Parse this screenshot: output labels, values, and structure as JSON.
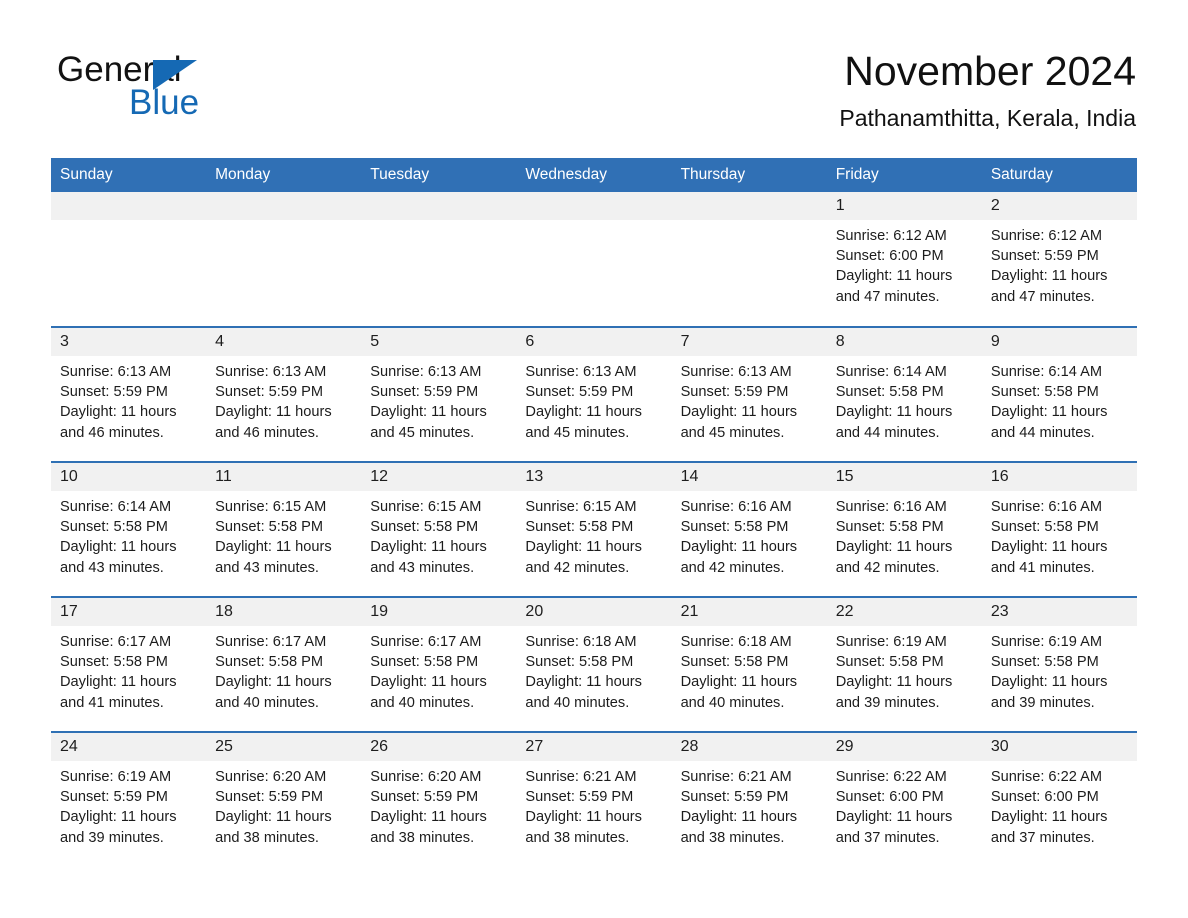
{
  "brand": {
    "name_part1": "General",
    "name_part2": "Blue",
    "flag_icon": "blue-triangle-flag-icon",
    "accent_color": "#1569b4"
  },
  "header": {
    "title": "November 2024",
    "location": "Pathanamthitta, Kerala, India"
  },
  "theme": {
    "header_row_bg": "#3070b5",
    "row_separator": "#2f70b4",
    "daynum_band_bg": "#f1f1f1",
    "page_bg": "#ffffff",
    "text": "#1c1c1c"
  },
  "calendar": {
    "weekday_headers": [
      "Sunday",
      "Monday",
      "Tuesday",
      "Wednesday",
      "Thursday",
      "Friday",
      "Saturday"
    ],
    "weeks": [
      [
        {
          "day": "",
          "lines": []
        },
        {
          "day": "",
          "lines": []
        },
        {
          "day": "",
          "lines": []
        },
        {
          "day": "",
          "lines": []
        },
        {
          "day": "",
          "lines": []
        },
        {
          "day": "1",
          "lines": [
            "Sunrise: 6:12 AM",
            "Sunset: 6:00 PM",
            "Daylight: 11 hours",
            "and 47 minutes."
          ]
        },
        {
          "day": "2",
          "lines": [
            "Sunrise: 6:12 AM",
            "Sunset: 5:59 PM",
            "Daylight: 11 hours",
            "and 47 minutes."
          ]
        }
      ],
      [
        {
          "day": "3",
          "lines": [
            "Sunrise: 6:13 AM",
            "Sunset: 5:59 PM",
            "Daylight: 11 hours",
            "and 46 minutes."
          ]
        },
        {
          "day": "4",
          "lines": [
            "Sunrise: 6:13 AM",
            "Sunset: 5:59 PM",
            "Daylight: 11 hours",
            "and 46 minutes."
          ]
        },
        {
          "day": "5",
          "lines": [
            "Sunrise: 6:13 AM",
            "Sunset: 5:59 PM",
            "Daylight: 11 hours",
            "and 45 minutes."
          ]
        },
        {
          "day": "6",
          "lines": [
            "Sunrise: 6:13 AM",
            "Sunset: 5:59 PM",
            "Daylight: 11 hours",
            "and 45 minutes."
          ]
        },
        {
          "day": "7",
          "lines": [
            "Sunrise: 6:13 AM",
            "Sunset: 5:59 PM",
            "Daylight: 11 hours",
            "and 45 minutes."
          ]
        },
        {
          "day": "8",
          "lines": [
            "Sunrise: 6:14 AM",
            "Sunset: 5:58 PM",
            "Daylight: 11 hours",
            "and 44 minutes."
          ]
        },
        {
          "day": "9",
          "lines": [
            "Sunrise: 6:14 AM",
            "Sunset: 5:58 PM",
            "Daylight: 11 hours",
            "and 44 minutes."
          ]
        }
      ],
      [
        {
          "day": "10",
          "lines": [
            "Sunrise: 6:14 AM",
            "Sunset: 5:58 PM",
            "Daylight: 11 hours",
            "and 43 minutes."
          ]
        },
        {
          "day": "11",
          "lines": [
            "Sunrise: 6:15 AM",
            "Sunset: 5:58 PM",
            "Daylight: 11 hours",
            "and 43 minutes."
          ]
        },
        {
          "day": "12",
          "lines": [
            "Sunrise: 6:15 AM",
            "Sunset: 5:58 PM",
            "Daylight: 11 hours",
            "and 43 minutes."
          ]
        },
        {
          "day": "13",
          "lines": [
            "Sunrise: 6:15 AM",
            "Sunset: 5:58 PM",
            "Daylight: 11 hours",
            "and 42 minutes."
          ]
        },
        {
          "day": "14",
          "lines": [
            "Sunrise: 6:16 AM",
            "Sunset: 5:58 PM",
            "Daylight: 11 hours",
            "and 42 minutes."
          ]
        },
        {
          "day": "15",
          "lines": [
            "Sunrise: 6:16 AM",
            "Sunset: 5:58 PM",
            "Daylight: 11 hours",
            "and 42 minutes."
          ]
        },
        {
          "day": "16",
          "lines": [
            "Sunrise: 6:16 AM",
            "Sunset: 5:58 PM",
            "Daylight: 11 hours",
            "and 41 minutes."
          ]
        }
      ],
      [
        {
          "day": "17",
          "lines": [
            "Sunrise: 6:17 AM",
            "Sunset: 5:58 PM",
            "Daylight: 11 hours",
            "and 41 minutes."
          ]
        },
        {
          "day": "18",
          "lines": [
            "Sunrise: 6:17 AM",
            "Sunset: 5:58 PM",
            "Daylight: 11 hours",
            "and 40 minutes."
          ]
        },
        {
          "day": "19",
          "lines": [
            "Sunrise: 6:17 AM",
            "Sunset: 5:58 PM",
            "Daylight: 11 hours",
            "and 40 minutes."
          ]
        },
        {
          "day": "20",
          "lines": [
            "Sunrise: 6:18 AM",
            "Sunset: 5:58 PM",
            "Daylight: 11 hours",
            "and 40 minutes."
          ]
        },
        {
          "day": "21",
          "lines": [
            "Sunrise: 6:18 AM",
            "Sunset: 5:58 PM",
            "Daylight: 11 hours",
            "and 40 minutes."
          ]
        },
        {
          "day": "22",
          "lines": [
            "Sunrise: 6:19 AM",
            "Sunset: 5:58 PM",
            "Daylight: 11 hours",
            "and 39 minutes."
          ]
        },
        {
          "day": "23",
          "lines": [
            "Sunrise: 6:19 AM",
            "Sunset: 5:58 PM",
            "Daylight: 11 hours",
            "and 39 minutes."
          ]
        }
      ],
      [
        {
          "day": "24",
          "lines": [
            "Sunrise: 6:19 AM",
            "Sunset: 5:59 PM",
            "Daylight: 11 hours",
            "and 39 minutes."
          ]
        },
        {
          "day": "25",
          "lines": [
            "Sunrise: 6:20 AM",
            "Sunset: 5:59 PM",
            "Daylight: 11 hours",
            "and 38 minutes."
          ]
        },
        {
          "day": "26",
          "lines": [
            "Sunrise: 6:20 AM",
            "Sunset: 5:59 PM",
            "Daylight: 11 hours",
            "and 38 minutes."
          ]
        },
        {
          "day": "27",
          "lines": [
            "Sunrise: 6:21 AM",
            "Sunset: 5:59 PM",
            "Daylight: 11 hours",
            "and 38 minutes."
          ]
        },
        {
          "day": "28",
          "lines": [
            "Sunrise: 6:21 AM",
            "Sunset: 5:59 PM",
            "Daylight: 11 hours",
            "and 38 minutes."
          ]
        },
        {
          "day": "29",
          "lines": [
            "Sunrise: 6:22 AM",
            "Sunset: 6:00 PM",
            "Daylight: 11 hours",
            "and 37 minutes."
          ]
        },
        {
          "day": "30",
          "lines": [
            "Sunrise: 6:22 AM",
            "Sunset: 6:00 PM",
            "Daylight: 11 hours",
            "and 37 minutes."
          ]
        }
      ]
    ]
  }
}
